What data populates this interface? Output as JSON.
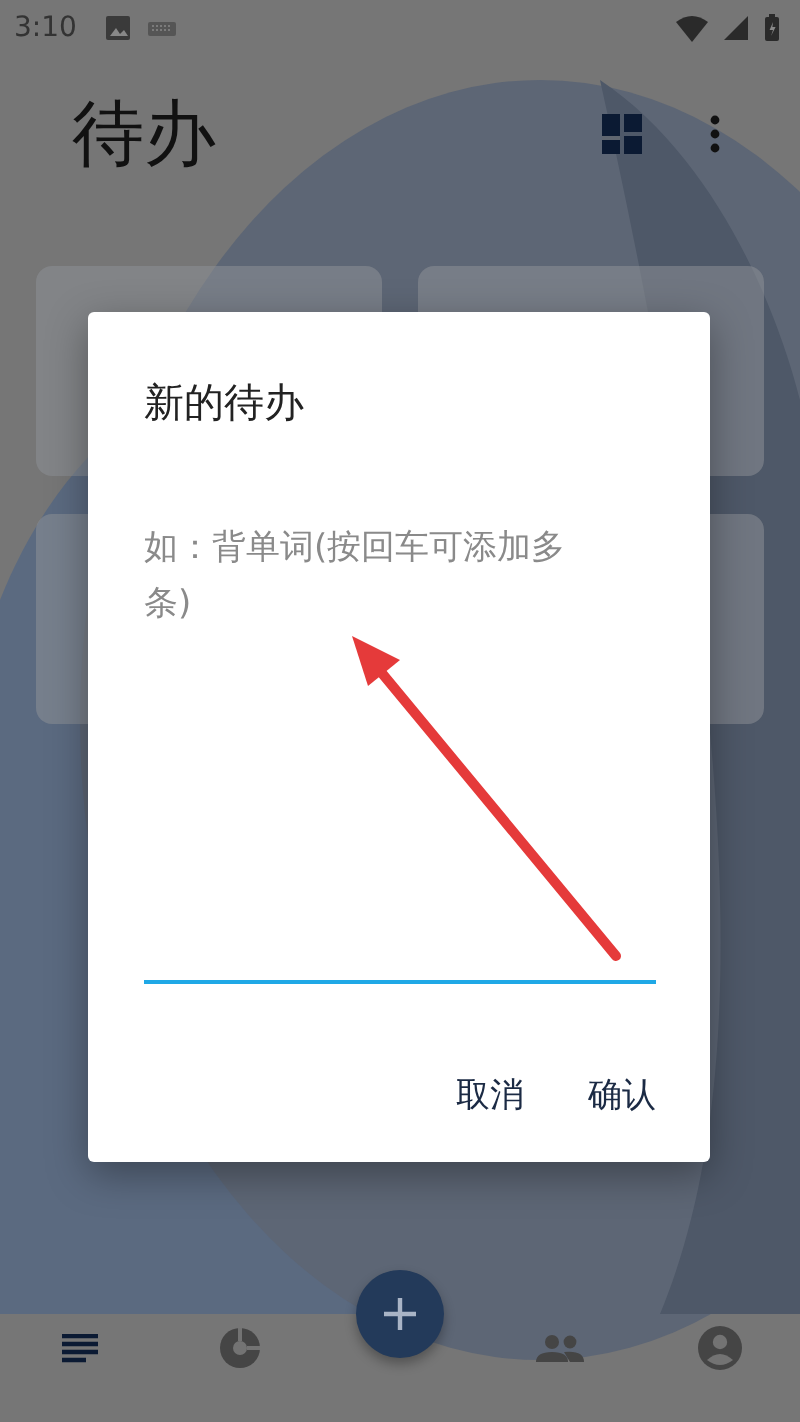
{
  "status_bar": {
    "time": "3:10"
  },
  "app_bar": {
    "title": "待办"
  },
  "cards": [
    {
      "kind": "card"
    },
    {
      "kind": "card"
    },
    {
      "kind": "card"
    },
    {
      "kind": "card"
    }
  ],
  "dialog": {
    "title": "新的待办",
    "input": {
      "placeholder": "如：背单词(按回车可添加多条)",
      "focused": true
    },
    "buttons": [
      {
        "label": "取消"
      },
      {
        "label": "确认"
      }
    ]
  },
  "bottom_nav": {
    "items": [
      {
        "selected": true
      },
      {
        "selected": false
      },
      {
        "selected": false
      },
      {
        "selected": false
      }
    ]
  }
}
